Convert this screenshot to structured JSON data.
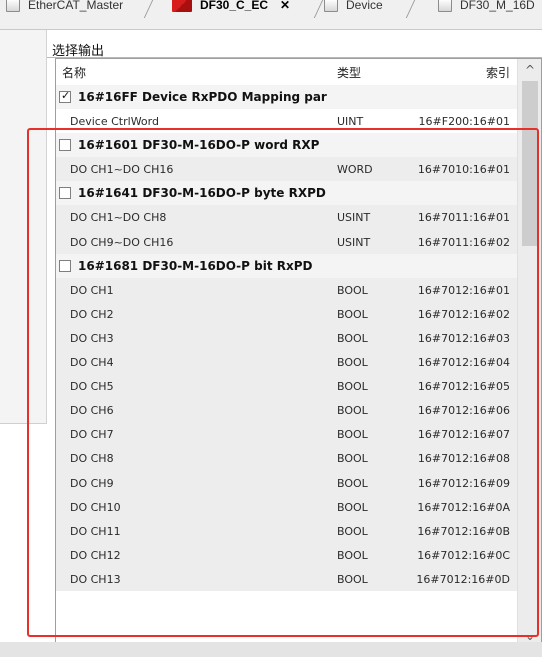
{
  "tabs": [
    {
      "label": "EtherCAT_Master",
      "icon": "device-icon"
    },
    {
      "label": "DF30_C_EC",
      "icon": "red-device-icon",
      "close": "✕"
    },
    {
      "label": "Device",
      "icon": "device-icon"
    },
    {
      "label": "DF30_M_16D",
      "icon": "device-icon"
    }
  ],
  "group_title": "选择输出",
  "columns": {
    "name": "名称",
    "type": "类型",
    "index": "索引"
  },
  "rows": [
    {
      "kind": "group",
      "checked": true,
      "name": "16#16FF Device RxPDO Mapping par"
    },
    {
      "kind": "item",
      "name": "Device CtrlWord",
      "type": "UINT",
      "index": "16#F200:16#01",
      "bg": "white"
    },
    {
      "kind": "group",
      "checked": false,
      "name": "16#1601  DF30-M-16DO-P  word RXP"
    },
    {
      "kind": "item",
      "name": "DO CH1~DO CH16",
      "type": "WORD",
      "index": "16#7010:16#01"
    },
    {
      "kind": "group",
      "checked": false,
      "name": "16#1641  DF30-M-16DO-P  byte RXPD"
    },
    {
      "kind": "item",
      "name": "DO CH1~DO CH8",
      "type": "USINT",
      "index": "16#7011:16#01"
    },
    {
      "kind": "item",
      "name": "DO CH9~DO CH16",
      "type": "USINT",
      "index": "16#7011:16#02"
    },
    {
      "kind": "group",
      "checked": false,
      "name": "16#1681  DF30-M-16DO-P   bit RxPD"
    },
    {
      "kind": "item",
      "name": "DO CH1",
      "type": "BOOL",
      "index": "16#7012:16#01"
    },
    {
      "kind": "item",
      "name": "DO CH2",
      "type": "BOOL",
      "index": "16#7012:16#02"
    },
    {
      "kind": "item",
      "name": "DO CH3",
      "type": "BOOL",
      "index": "16#7012:16#03"
    },
    {
      "kind": "item",
      "name": "DO CH4",
      "type": "BOOL",
      "index": "16#7012:16#04"
    },
    {
      "kind": "item",
      "name": "DO CH5",
      "type": "BOOL",
      "index": "16#7012:16#05"
    },
    {
      "kind": "item",
      "name": "DO CH6",
      "type": "BOOL",
      "index": "16#7012:16#06"
    },
    {
      "kind": "item",
      "name": "DO CH7",
      "type": "BOOL",
      "index": "16#7012:16#07"
    },
    {
      "kind": "item",
      "name": "DO CH8",
      "type": "BOOL",
      "index": "16#7012:16#08"
    },
    {
      "kind": "item",
      "name": "DO CH9",
      "type": "BOOL",
      "index": "16#7012:16#09"
    },
    {
      "kind": "item",
      "name": "DO CH10",
      "type": "BOOL",
      "index": "16#7012:16#0A"
    },
    {
      "kind": "item",
      "name": "DO CH11",
      "type": "BOOL",
      "index": "16#7012:16#0B"
    },
    {
      "kind": "item",
      "name": "DO CH12",
      "type": "BOOL",
      "index": "16#7012:16#0C"
    },
    {
      "kind": "item",
      "name": "DO CH13",
      "type": "BOOL",
      "index": "16#7012:16#0D"
    }
  ],
  "scrollbar": {
    "up": "^",
    "down": "⌄"
  },
  "colors": {
    "highlight": "#e8302a",
    "row_bg": "#ededed",
    "group_bg": "#f4f4f4"
  }
}
